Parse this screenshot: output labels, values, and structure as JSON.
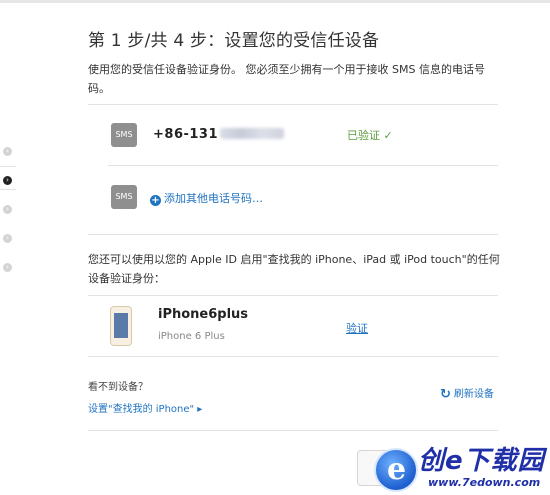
{
  "title": "第 1 步/共 4 步：设置您的受信任设备",
  "intro": "使用您的受信任设备验证身份。 您必须至少拥有一个用于接收 SMS 信息的电话号码。",
  "sms_badge": "SMS",
  "phone": {
    "number_visible": "+86-131",
    "status": "已验证",
    "status_icon": "✓"
  },
  "add_phone": {
    "icon": "+",
    "label": "添加其他电话号码…"
  },
  "find_description": "您还可以使用以您的 Apple ID 启用\"查找我的 iPhone、iPad 或 iPod touch\"的任何设备验证身份：",
  "device": {
    "name": "iPhone6plus",
    "model": "iPhone 6 Plus",
    "verify_label": "验证"
  },
  "cant_see": "看不到设备？",
  "setup_find_iphone": "设置\"查找我的 iPhone\" ▸",
  "refresh": {
    "icon": "↻",
    "label": "刷新设备"
  },
  "left_steps": [
    {
      "icon": "chevron-right-icon",
      "active": false
    },
    {
      "icon": "chevron-right-icon",
      "active": true
    },
    {
      "icon": "chevron-right-icon",
      "active": false
    },
    {
      "icon": "chevron-right-icon",
      "active": false
    },
    {
      "icon": "chevron-right-icon",
      "active": false
    }
  ],
  "watermark": {
    "logo_letter": "e",
    "brand": "创e下载园",
    "url": "www.7edown.com"
  },
  "colors": {
    "link": "#1f73c1",
    "verified": "#5a9e3b",
    "sms_badge": "#8f8f8f"
  }
}
